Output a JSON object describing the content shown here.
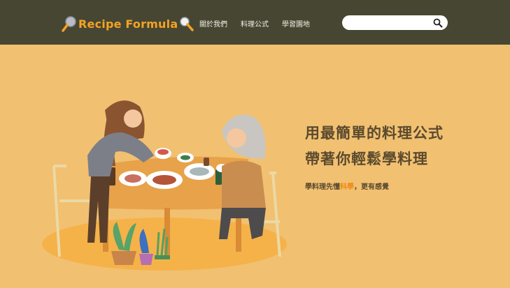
{
  "brand": {
    "name": "Recipe Formula",
    "color": "#f3a324"
  },
  "nav": {
    "items": [
      "關於我們",
      "料理公式",
      "學習園地"
    ]
  },
  "search": {
    "placeholder": "",
    "value": ""
  },
  "icons": {
    "logo_left": "magnifier-icon",
    "logo_right": "magnifier-icon",
    "search": "search-icon"
  },
  "hero": {
    "headline_line1": "用最簡單的料理公式",
    "headline_line2": "帶著你輕鬆學料理",
    "sub_prefix": "學料理先懂",
    "sub_highlight": "科學",
    "sub_suffix": "，更有感覺",
    "illustration": "two-women-dining-table-illustration"
  },
  "colors": {
    "header_bg": "#474632",
    "page_bg": "#f1c071",
    "accent": "#f08a12",
    "text": "#5b4a2e"
  }
}
